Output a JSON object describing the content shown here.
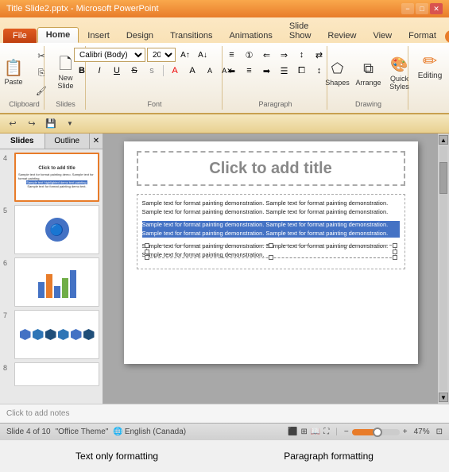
{
  "titlebar": {
    "title": "Title Slide2.pptx - Microsoft PowerPoint",
    "min_label": "−",
    "max_label": "□",
    "close_label": "✕"
  },
  "ribbon": {
    "tabs": [
      "File",
      "Home",
      "Insert",
      "Design",
      "Transitions",
      "Animations",
      "Slide Show",
      "Review",
      "View",
      "Format"
    ],
    "active_tab": "Home",
    "groups": {
      "clipboard": {
        "label": "Clipboard",
        "paste_label": "Paste"
      },
      "slides": {
        "label": "Slides",
        "new_slide_label": "New\nSlide"
      },
      "font": {
        "label": "Font",
        "font_name": "Calibri (Body)",
        "font_size": "20",
        "bold": "B",
        "italic": "I",
        "underline": "U",
        "strikethrough": "S",
        "shadow": "S"
      },
      "paragraph": {
        "label": "Paragraph"
      },
      "drawing": {
        "label": "Drawing",
        "shapes_label": "Shapes",
        "arrange_label": "Arrange",
        "quick_styles_label": "Quick\nStyles"
      },
      "editing": {
        "label": "Editing"
      }
    }
  },
  "qat": {
    "undo_label": "↩",
    "redo_label": "↪",
    "save_label": "💾"
  },
  "panels": {
    "slides_tab": "Slides",
    "outline_tab": "Outline",
    "slides": [
      {
        "num": "4",
        "selected": true
      },
      {
        "num": "5",
        "selected": false
      },
      {
        "num": "6",
        "selected": false
      },
      {
        "num": "7",
        "selected": false
      },
      {
        "num": "8",
        "selected": false
      }
    ]
  },
  "slide": {
    "title_placeholder": "Click to add title",
    "para1": "Sample text for format painting demonstration. Sample text for format painting demonstration. Sample text for format painting demonstration. Sample text for format painting demonstration.",
    "para2_highlighted": "Sample text for format painting demonstration. Sample text for format painting demonstration. Sample text for format painting demonstration. Sample text for format painting demonstration.",
    "para3": "Sample text for format painting demonstration. Sample text for format painting demonstration. Sample text for format painting demonstration."
  },
  "notes": {
    "placeholder": "Click to add notes"
  },
  "statusbar": {
    "slide_info": "Slide 4 of 10",
    "theme": "\"Office Theme\"",
    "language": "English (Canada)",
    "zoom": "47%"
  },
  "annotations": {
    "left_label": "Text only formatting",
    "right_label": "Paragraph formatting"
  }
}
